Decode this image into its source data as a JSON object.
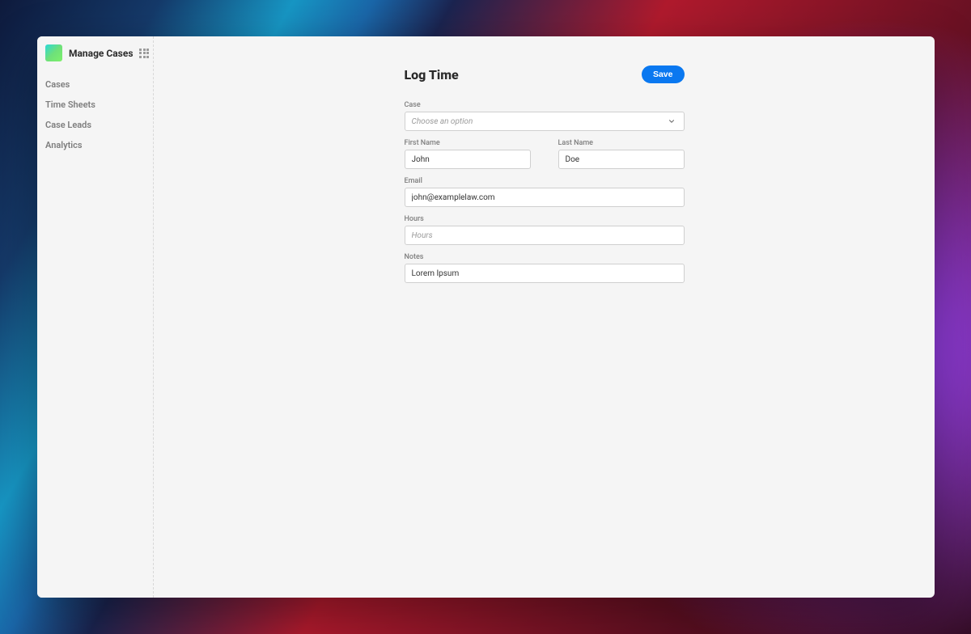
{
  "app": {
    "title": "Manage Cases"
  },
  "sidebar": {
    "items": [
      {
        "label": "Cases"
      },
      {
        "label": "Time Sheets"
      },
      {
        "label": "Case Leads"
      },
      {
        "label": "Analytics"
      }
    ]
  },
  "page": {
    "title": "Log Time",
    "save_label": "Save"
  },
  "form": {
    "case": {
      "label": "Case",
      "placeholder": "Choose an option",
      "value": ""
    },
    "first_name": {
      "label": "First Name",
      "value": "John"
    },
    "last_name": {
      "label": "Last Name",
      "value": "Doe"
    },
    "email": {
      "label": "Email",
      "value": "john@examplelaw.com"
    },
    "hours": {
      "label": "Hours",
      "placeholder": "Hours",
      "value": ""
    },
    "notes": {
      "label": "Notes",
      "value": "Lorem Ipsum"
    }
  },
  "colors": {
    "accent": "#0a78f0"
  }
}
